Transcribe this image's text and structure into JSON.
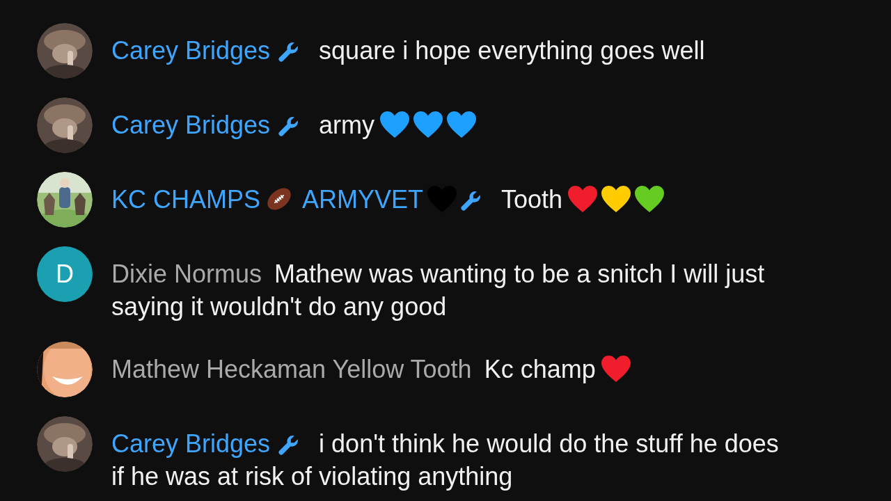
{
  "messages": [
    {
      "avatar": {
        "kind": "picture"
      },
      "author": [
        {
          "kind": "text",
          "text": "Carey Bridges"
        }
      ],
      "moderator": true,
      "lines": [
        "square i hope everything goes well"
      ]
    },
    {
      "avatar": {
        "kind": "picture"
      },
      "author": [
        {
          "kind": "text",
          "text": "Carey Bridges"
        }
      ],
      "moderator": true,
      "lines": [
        "army"
      ],
      "hearts": [
        {
          "color": "#1ea0ff"
        },
        {
          "color": "#1ea0ff"
        },
        {
          "color": "#1ea0ff"
        }
      ]
    },
    {
      "avatar": {
        "kind": "picture"
      },
      "author": [
        {
          "kind": "text",
          "text": "KC CHAMPS"
        },
        {
          "kind": "football"
        },
        {
          "kind": "text",
          "text": "ARMYVET"
        },
        {
          "kind": "heart",
          "color": "#000000"
        }
      ],
      "moderator": true,
      "lines": [
        "Tooth"
      ],
      "hearts": [
        {
          "color": "#f01e2c"
        },
        {
          "color": "#ffcc00"
        },
        {
          "color": "#66cc22"
        }
      ]
    },
    {
      "avatar": {
        "kind": "letter",
        "letter": "D",
        "color": "#1aa0b0"
      },
      "author": [
        {
          "kind": "text",
          "text": "Dixie Normus"
        }
      ],
      "moderator": false,
      "lines": [
        "Mathew was wanting to be a snitch I will just",
        "saying it wouldn't do any good"
      ]
    },
    {
      "avatar": {
        "kind": "picture"
      },
      "author": [
        {
          "kind": "text",
          "text": "Mathew Heckaman Yellow Tooth"
        }
      ],
      "moderator": false,
      "lines": [
        "Kc champ"
      ],
      "hearts": [
        {
          "color": "#f01e2c"
        }
      ]
    },
    {
      "avatar": {
        "kind": "picture"
      },
      "author": [
        {
          "kind": "text",
          "text": "Carey Bridges"
        }
      ],
      "moderator": true,
      "lines": [
        "i don't think he would do the stuff he does",
        "if he was at risk of violating anything"
      ]
    }
  ]
}
